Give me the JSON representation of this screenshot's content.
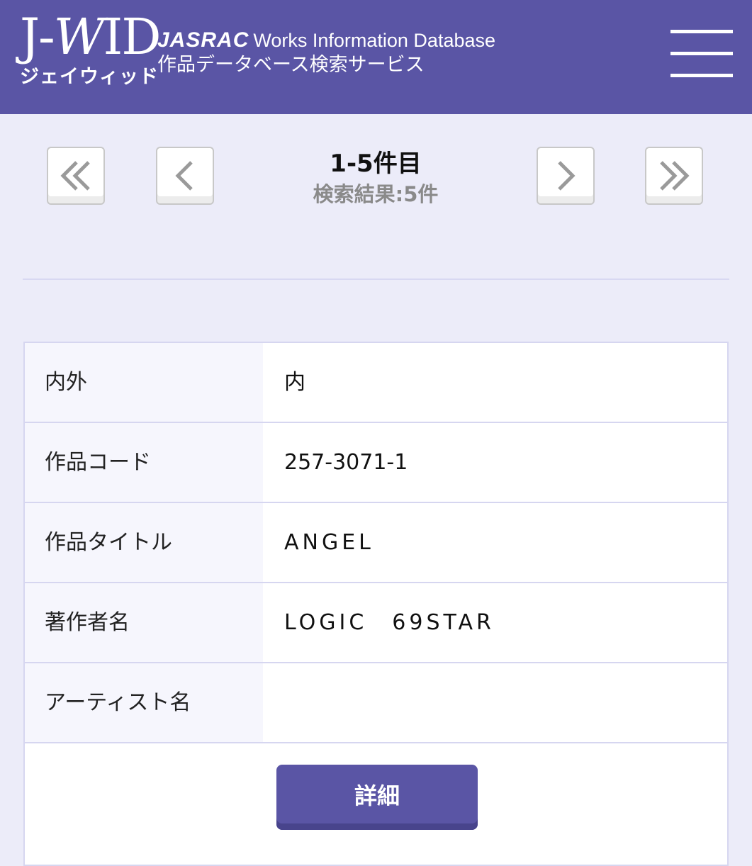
{
  "header": {
    "logo_text_j": "J-",
    "logo_text_w": "W",
    "logo_text_id": "ID",
    "logo_kana": "ジェイウィッド",
    "brand_jasrac": "JASRAC",
    "brand_english": "Works Information Database",
    "brand_japanese": "作品データベース検索サービス",
    "menu_icon": "hamburger-menu-icon"
  },
  "pager": {
    "first_icon": "double-chevron-left-icon",
    "prev_icon": "chevron-left-icon",
    "next_icon": "chevron-right-icon",
    "last_icon": "double-chevron-right-icon",
    "range_label": "1-5件目",
    "total_label": "検索結果:5件"
  },
  "result": {
    "rows": [
      {
        "key": "内外",
        "value": "内"
      },
      {
        "key": "作品コード",
        "value": "257-3071-1"
      },
      {
        "key": "作品タイトル",
        "value": "ANGEL"
      },
      {
        "key": "著作者名",
        "value": "LOGIC　69STAR"
      },
      {
        "key": "アーティスト名",
        "value": ""
      }
    ],
    "detail_button_label": "詳細"
  },
  "colors": {
    "header_bg": "#5a55a5",
    "page_bg": "#ececf9",
    "button_bg": "#5a55a5"
  }
}
